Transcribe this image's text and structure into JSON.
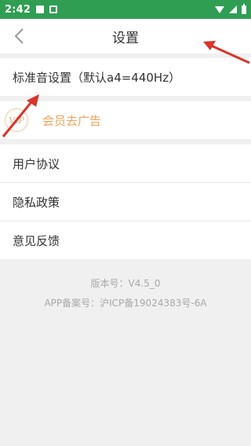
{
  "status_bar": {
    "time": "2:42",
    "left_icons": [
      "image-icon",
      "app-icon"
    ],
    "right_icons": [
      "wifi-icon",
      "signal-icon",
      "battery-icon"
    ],
    "color": "#2f9e52"
  },
  "header": {
    "title": "设置",
    "back_icon": "chevron-left-icon"
  },
  "settings": {
    "pitch_label": "标准音设置（默认a4=440Hz）",
    "vip_badge": "VIP",
    "vip_label": "会员去广告",
    "user_agreement": "用户协议",
    "privacy_policy": "隐私政策",
    "feedback": "意见反馈"
  },
  "footer": {
    "version": "版本号：V4.5_0",
    "icp": "APP备案号：沪ICP备19024383号-6A"
  },
  "annotations": {
    "arrow_color": "#d9342b"
  }
}
